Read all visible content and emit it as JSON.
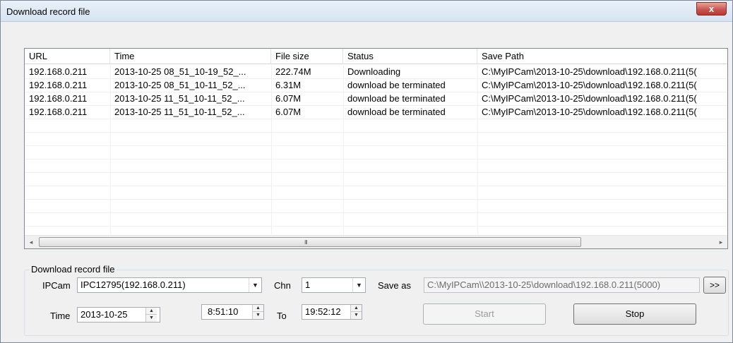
{
  "window": {
    "title": "Download record file",
    "close_glyph": "x"
  },
  "list": {
    "columns": [
      {
        "label": "URL"
      },
      {
        "label": "Time"
      },
      {
        "label": "File size"
      },
      {
        "label": "Status"
      },
      {
        "label": "Save Path"
      }
    ],
    "rows": [
      {
        "url": "192.168.0.211",
        "time": "2013-10-25 08_51_10-19_52_...",
        "size": "222.74M",
        "status": "Downloading",
        "path": "C:\\MyIPCam\\2013-10-25\\download\\192.168.0.211(5("
      },
      {
        "url": "192.168.0.211",
        "time": "2013-10-25 08_51_10-11_52_...",
        "size": "6.31M",
        "status": "download be terminated",
        "path": "C:\\MyIPCam\\2013-10-25\\download\\192.168.0.211(5("
      },
      {
        "url": "192.168.0.211",
        "time": "2013-10-25 11_51_10-11_52_...",
        "size": "6.07M",
        "status": "download be terminated",
        "path": "C:\\MyIPCam\\2013-10-25\\download\\192.168.0.211(5("
      },
      {
        "url": "192.168.0.211",
        "time": "2013-10-25 11_51_10-11_52_...",
        "size": "6.07M",
        "status": "download be terminated",
        "path": "C:\\MyIPCam\\2013-10-25\\download\\192.168.0.211(5("
      }
    ],
    "scroll_left_icon": "◂",
    "scroll_right_icon": "▸",
    "scroll_grip": "III"
  },
  "form": {
    "group_label": "Download record file",
    "ipcam_label": "IPCam",
    "ipcam_value": "IPC12795(192.168.0.211)",
    "chn_label": "Chn",
    "chn_value": "1",
    "saveas_label": "Save as",
    "saveas_value": "C:\\MyIPCam\\\\2013-10-25\\download\\192.168.0.211(5000)",
    "browse_label": ">>",
    "time_label": "Time",
    "date_value": "2013-10-25",
    "time_from": "8:51:10",
    "to_label": "To",
    "time_to": "19:52:12",
    "start_label": "Start",
    "stop_label": "Stop"
  }
}
